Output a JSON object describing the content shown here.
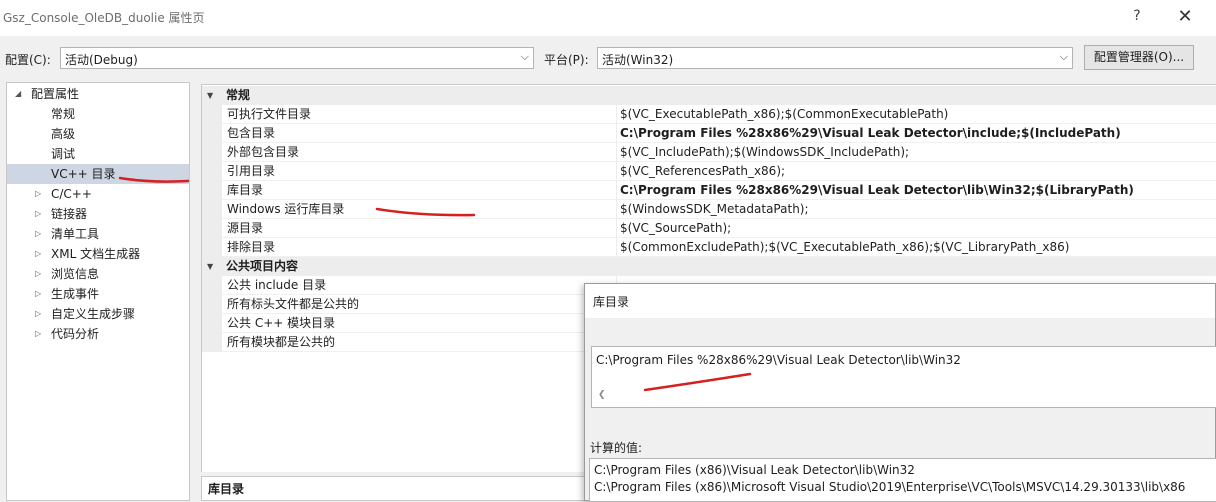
{
  "window": {
    "title": "Gsz_Console_OleDB_duolie 属性页",
    "help_glyph": "?",
    "close_glyph": "✕"
  },
  "config": {
    "config_label": "配置(C):",
    "config_value": "活动(Debug)",
    "platform_label": "平台(P):",
    "platform_value": "活动(Win32)",
    "manager_button": "配置管理器(O)..."
  },
  "tree": {
    "root": "配置属性",
    "items": [
      {
        "label": "常规"
      },
      {
        "label": "高级"
      },
      {
        "label": "调试"
      },
      {
        "label": "VC++ 目录"
      },
      {
        "label": "C/C++"
      },
      {
        "label": "链接器"
      },
      {
        "label": "清单工具"
      },
      {
        "label": "XML 文档生成器"
      },
      {
        "label": "浏览信息"
      },
      {
        "label": "生成事件"
      },
      {
        "label": "自定义生成步骤"
      },
      {
        "label": "代码分析"
      }
    ]
  },
  "grid": {
    "categories": [
      {
        "name": "常规",
        "rows": [
          {
            "name": "可执行文件目录",
            "value": "$(VC_ExecutablePath_x86);$(CommonExecutablePath)"
          },
          {
            "name": "包含目录",
            "value": "C:\\Program Files %28x86%29\\Visual Leak Detector\\include;$(IncludePath)"
          },
          {
            "name": "外部包含目录",
            "value": "$(VC_IncludePath);$(WindowsSDK_IncludePath);"
          },
          {
            "name": "引用目录",
            "value": "$(VC_ReferencesPath_x86);"
          },
          {
            "name": "库目录",
            "value": "C:\\Program Files %28x86%29\\Visual Leak Detector\\lib\\Win32;$(LibraryPath)"
          },
          {
            "name": "Windows 运行库目录",
            "value": "$(WindowsSDK_MetadataPath);"
          },
          {
            "name": "源目录",
            "value": "$(VC_SourcePath);"
          },
          {
            "name": "排除目录",
            "value": "$(CommonExcludePath);$(VC_ExecutablePath_x86);$(VC_LibraryPath_x86)"
          }
        ]
      },
      {
        "name": "公共项目内容",
        "rows": [
          {
            "name": "公共 include 目录",
            "value": ""
          },
          {
            "name": "所有标头文件都是公共的",
            "value": ""
          },
          {
            "name": "公共 C++ 模块目录",
            "value": ""
          },
          {
            "name": "所有模块都是公共的",
            "value": ""
          }
        ]
      }
    ]
  },
  "description": {
    "title": "库目录"
  },
  "popup": {
    "title": "库目录",
    "edit_value": "C:\\Program Files %28x86%29\\Visual Leak Detector\\lib\\Win32",
    "computed_label": "计算的值:",
    "computed_lines": [
      "C:\\Program Files (x86)\\Visual Leak Detector\\lib\\Win32",
      "C:\\Program Files (x86)\\Microsoft Visual Studio\\2019\\Enterprise\\VC\\Tools\\MSVC\\14.29.30133\\lib\\x86"
    ]
  },
  "annotation_color": "#d42020"
}
